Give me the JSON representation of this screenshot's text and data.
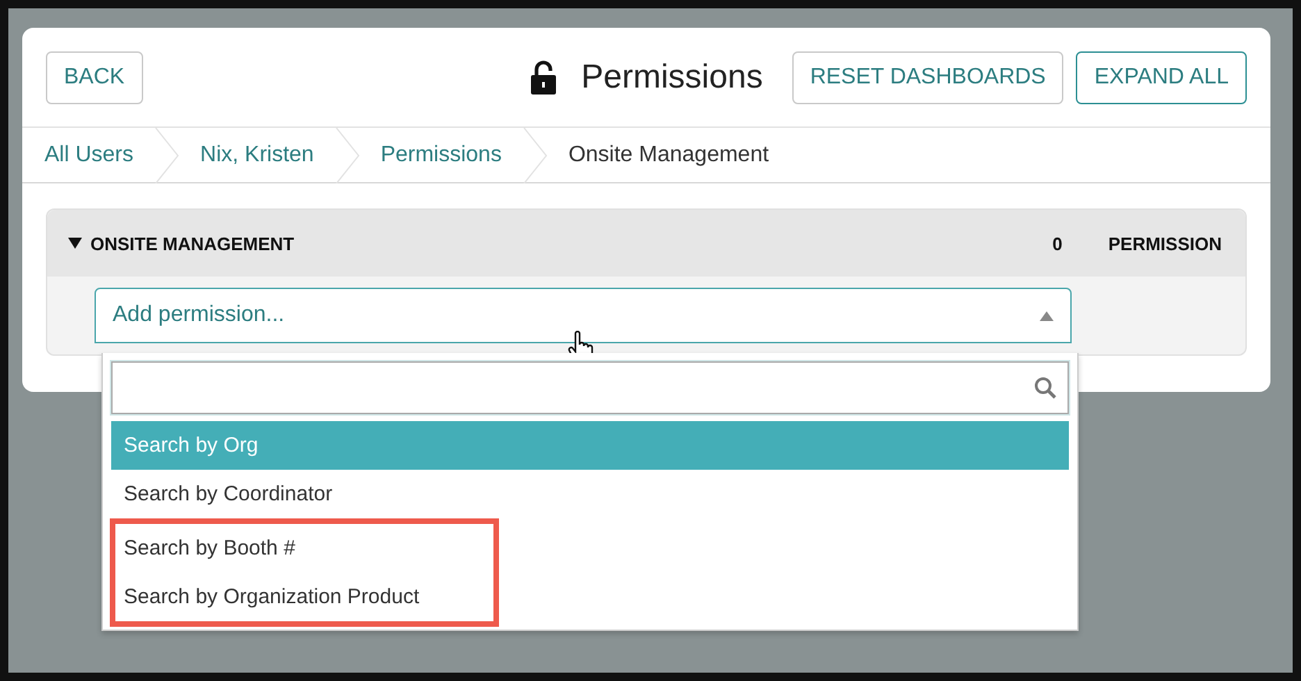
{
  "header": {
    "back": "BACK",
    "title": "Permissions",
    "locked": false,
    "buttons": [
      {
        "label": "RESET DASHBOARDS",
        "emphasized": false
      },
      {
        "label": "EXPAND ALL",
        "emphasized": true
      }
    ]
  },
  "breadcrumbs": [
    {
      "label": "All Users",
      "current": false
    },
    {
      "label": "Nix, Kristen",
      "current": false
    },
    {
      "label": "Permissions",
      "current": false
    },
    {
      "label": "Onsite Management",
      "current": true
    }
  ],
  "section": {
    "title": "ONSITE MANAGEMENT",
    "expanded": true,
    "count": "0",
    "column": "PERMISSION"
  },
  "select": {
    "placeholder": "Add permission...",
    "open": true
  },
  "options": [
    {
      "label": "Search by Org",
      "selected": true,
      "highlighted": false
    },
    {
      "label": "Search by Coordinator",
      "selected": false,
      "highlighted": false
    },
    {
      "label": "Search by Booth #",
      "selected": false,
      "highlighted": true
    },
    {
      "label": "Search by Organization Product",
      "selected": false,
      "highlighted": true
    }
  ]
}
